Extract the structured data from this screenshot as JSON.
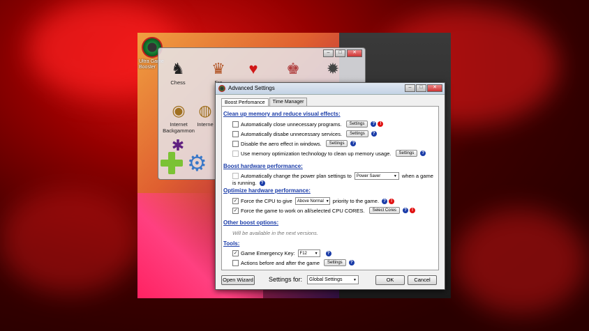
{
  "desktop": {
    "icon_label": "Ultra Game Booster",
    "colors": {
      "accent": "#1a3ca8",
      "danger": "#e01010",
      "plus": "#7bc234",
      "gear": "#3a78c8"
    }
  },
  "launcher": {
    "games": [
      {
        "label": "Chess",
        "icon": "chess-icon"
      },
      {
        "label": "Fre",
        "icon": "freecell-icon"
      },
      {
        "label": "",
        "icon": "hearts-icon"
      },
      {
        "label": "",
        "icon": "mahjong-icon"
      },
      {
        "label": "",
        "icon": "minesweeper-icon"
      },
      {
        "label": "Internet Backgammon",
        "icon": "backgammon-icon"
      },
      {
        "label": "Interne",
        "icon": "internet-game-icon"
      },
      {
        "label": "",
        "icon": "spider-icon"
      }
    ],
    "titlebar": {
      "minimize": "–",
      "maximize": "□",
      "close": "✕"
    }
  },
  "dialog": {
    "title": "Advanced Settings",
    "titlebar": {
      "minimize": "–",
      "maximize": "□",
      "close": "✕"
    },
    "tabs": [
      "Boost Perfomance",
      "Time Manager"
    ],
    "sections": {
      "clean_up": "Clean up memory and reduce visual effects:",
      "boost_hw": "Boost hardware performance:",
      "optimize_hw": "Optimize hardware performance:",
      "other": "Other boost options:",
      "tools": "Tools:"
    },
    "options": {
      "close_programs": "Automatically close unnecessary programs.",
      "disable_services": "Automatically disabe unnecessary services.",
      "disable_aero": "Disable the aero effect in windows.",
      "memory_opt": "Use memory optimization technology to clean up memory usage.",
      "power_plan_pre": "Automatically change the power plan settings to",
      "power_plan_post": "when a game",
      "power_plan_line2": "is running.",
      "power_plan_value": "Power Saver",
      "cpu_pre": "Force the CPU  to give",
      "cpu_value": "Above Normal",
      "cpu_post": "priority to the game.",
      "cores": "Force the game to work on all/selected CPU CORES.",
      "select_cores": "Select Cores",
      "other_note": "Will be available in the next versions.",
      "emergency_key": "Game Emergency Key:",
      "emergency_value": "F12",
      "actions": "Actions before and after the game"
    },
    "settings_label": "Settings",
    "help_symbol": "?",
    "warn_symbol": "!",
    "check_symbol": "✓",
    "checked": {
      "close_programs": false,
      "disable_services": false,
      "disable_aero": false,
      "memory_opt": false,
      "power_plan": false,
      "cpu": true,
      "cores": true,
      "emergency_key": true,
      "actions": false
    },
    "footer": {
      "open_wizard": "Open Wizard",
      "settings_for_label": "Settings for:",
      "settings_for_value": "Global Settings",
      "ok": "OK",
      "cancel": "Cancel"
    }
  }
}
